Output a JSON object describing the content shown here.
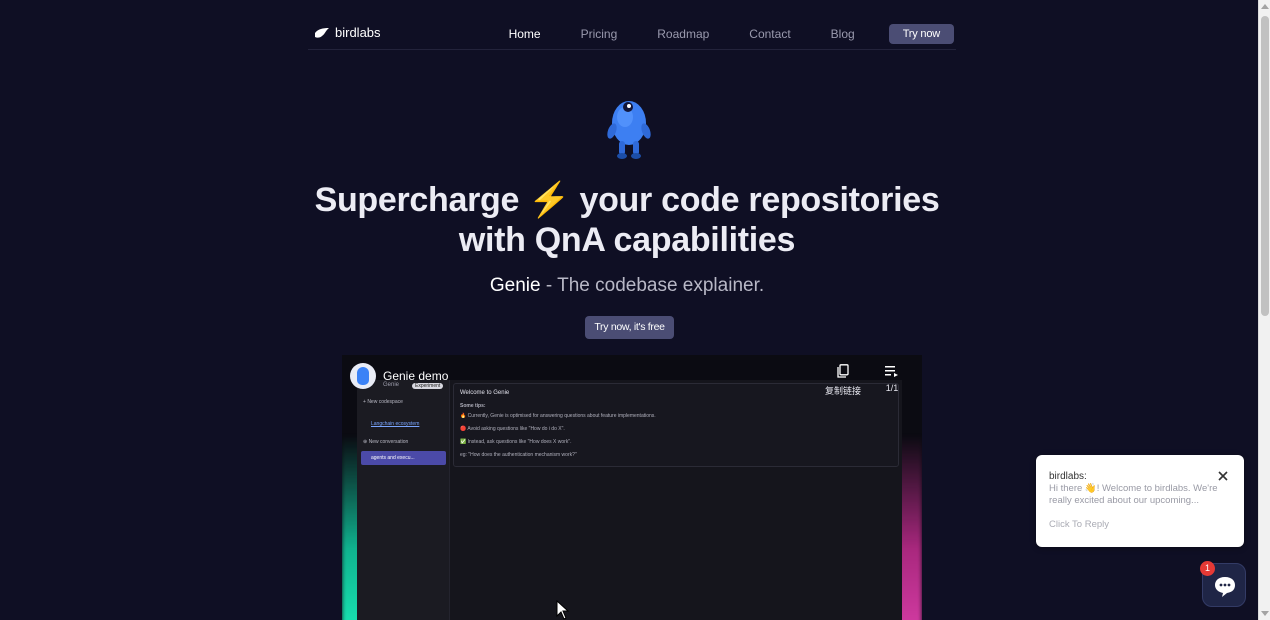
{
  "nav": {
    "brand": "birdlabs",
    "links": [
      "Home",
      "Pricing",
      "Roadmap",
      "Contact",
      "Blog"
    ],
    "cta": "Try now"
  },
  "hero": {
    "headline_part1": "Supercharge",
    "headline_emoji": "⚡",
    "headline_part2": "your code repositories with QnA capabilities",
    "sub_strong": "Genie",
    "sub_rest": " - The codebase explainer.",
    "cta": "Try now, it's free"
  },
  "video": {
    "title": "Genie demo",
    "channel": "Genie",
    "badge": "Experiment",
    "copy_label": "复制链接",
    "playlist_label": "1/1",
    "sidebar": {
      "new_codespace": "New codespace",
      "codespace": "Langchain ecosystem",
      "new_conversation": "New conversation",
      "conversation": "agents and execu..."
    },
    "main": {
      "welcome": "Welcome to Genie",
      "tips_title": "Some tips:",
      "tip1": "🔥 Currently, Genie is optimised for answering questions about feature implementations.",
      "tip2": "🔴 Avoid asking questions like \"How do i do X\".",
      "tip3": "✅ Instead, ask questions like \"How does X work\".",
      "example": "eg: \"How does the authentication mechanism work?\""
    }
  },
  "chat": {
    "from": "birdlabs:",
    "message": "Hi there 👋! Welcome to birdlabs. We're really excited about our upcoming...",
    "reply": "Click To Reply",
    "badge_count": "1"
  },
  "colors": {
    "background": "#0f0f24",
    "accent": "#4b4d74",
    "chat_badge": "#e53935"
  },
  "icons": [
    "bird-logo-icon",
    "copy-icon",
    "playlist-icon",
    "close-icon",
    "chat-bubble-icon",
    "cursor-icon"
  ]
}
